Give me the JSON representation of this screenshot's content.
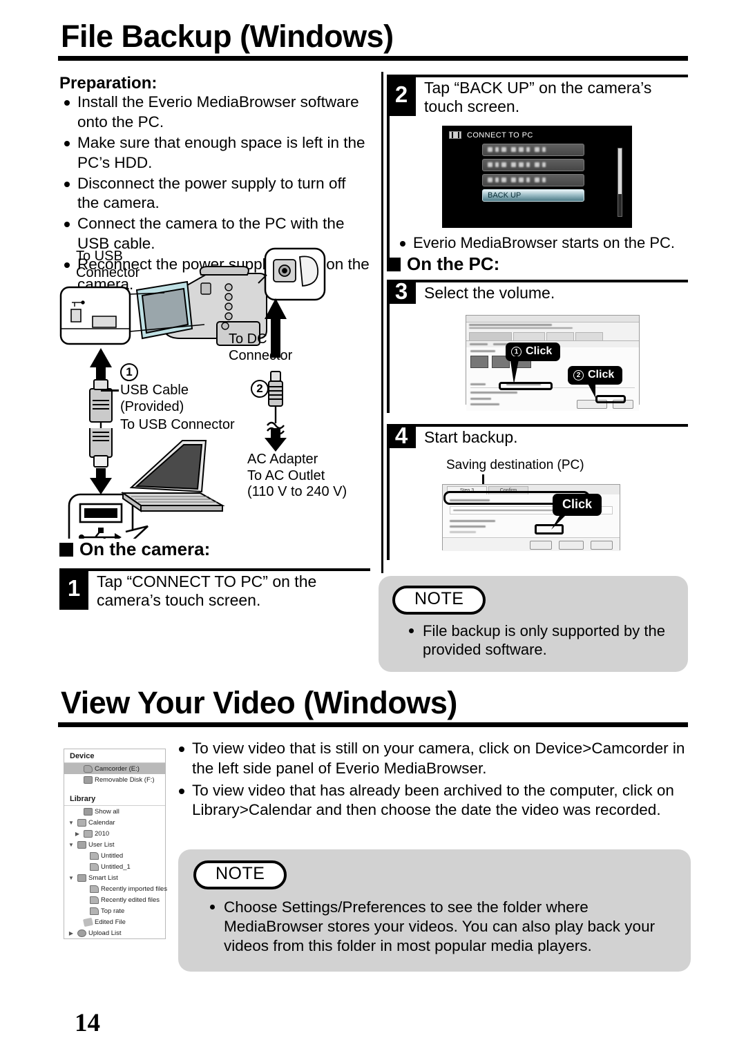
{
  "document": {
    "page_number": "14"
  },
  "section1": {
    "title": "File Backup (Windows)",
    "preparation": {
      "heading": "Preparation:",
      "items": [
        "Install the Everio MediaBrowser software onto the PC.",
        "Make sure that enough space is left in the PC’s HDD.",
        "Disconnect the power supply to turn off the camera.",
        "Connect the camera to the PC with the USB cable.",
        "Reconnect the power supply to turn on the camera."
      ]
    },
    "diagram": {
      "label_usb_connector_camera": "To USB\nConnector",
      "label_dc_connector": "To DC\nConnector",
      "label_usb_cable": "USB Cable\n(Provided)",
      "label_to_usb_connector_pc": "To USB Connector",
      "label_ac_adapter": "AC Adapter\nTo AC Outlet\n(110 V to 240 V)",
      "marker_1": "1",
      "marker_2": "2"
    },
    "on_the_camera": {
      "heading": "On the camera:",
      "step1": {
        "number": "1",
        "text": "Tap “CONNECT TO PC” on the camera’s touch screen."
      }
    },
    "step2": {
      "number": "2",
      "text": "Tap “BACK UP” on the camera’s touch screen.",
      "lcd": {
        "title": "CONNECT TO PC",
        "selected_item": "BACK UP",
        "hidden_items": 3
      },
      "note_bullet": "Everio MediaBrowser starts on the PC."
    },
    "on_the_pc": {
      "heading": "On the PC:",
      "step3": {
        "number": "3",
        "text": "Select the volume.",
        "callout1": {
          "index": "1",
          "label": "Click"
        },
        "callout2": {
          "index": "2",
          "label": "Click"
        }
      },
      "step4": {
        "number": "4",
        "text": "Start backup.",
        "caption": "Saving destination (PC)",
        "callout": {
          "label": "Click"
        },
        "shot_tabs": [
          "Step.3",
          "Confirm"
        ]
      }
    },
    "note": {
      "badge": "NOTE",
      "items": [
        "File backup is only supported by the provided software."
      ]
    }
  },
  "section2": {
    "title": "View Your Video (Windows)",
    "bullets": [
      "To view video that is still on your camera, click on Device>Camcorder in the left side panel of Everio MediaBrowser.",
      "To view video that has already been archived to the computer, click on Library>Calendar and then choose the date the video was recorded."
    ],
    "tree": {
      "groups": [
        {
          "label": "Device",
          "items": [
            {
              "label": "Camcorder (E:)",
              "icon": "camcorder-icon",
              "selected": true,
              "arrow": "",
              "indent": 1
            },
            {
              "label": "Removable Disk (F:)",
              "icon": "disk-icon",
              "selected": false,
              "arrow": "",
              "indent": 1
            }
          ]
        },
        {
          "label": "Library",
          "items": [
            {
              "label": "Show all",
              "icon": "folder-icon",
              "selected": false,
              "arrow": "",
              "indent": 1
            },
            {
              "label": "Calendar",
              "icon": "calendar-icon",
              "selected": false,
              "arrow": "▼",
              "indent": 0
            },
            {
              "label": "2010",
              "icon": "calendar-icon",
              "selected": false,
              "arrow": "▶",
              "indent": 1
            },
            {
              "label": "User List",
              "icon": "list-icon",
              "selected": false,
              "arrow": "▼",
              "indent": 0
            },
            {
              "label": "Untitled",
              "icon": "flag-icon",
              "selected": false,
              "arrow": "",
              "indent": 2
            },
            {
              "label": "Untitled_1",
              "icon": "flag-icon",
              "selected": false,
              "arrow": "",
              "indent": 2
            },
            {
              "label": "Smart List",
              "icon": "list-icon",
              "selected": false,
              "arrow": "▼",
              "indent": 0
            },
            {
              "label": "Recently imported files",
              "icon": "flag-icon",
              "selected": false,
              "arrow": "",
              "indent": 2
            },
            {
              "label": "Recently edited files",
              "icon": "flag-icon",
              "selected": false,
              "arrow": "",
              "indent": 2
            },
            {
              "label": "Top rate",
              "icon": "flag-icon",
              "selected": false,
              "arrow": "",
              "indent": 2
            },
            {
              "label": "Edited File",
              "icon": "edited-icon",
              "selected": false,
              "arrow": "",
              "indent": 1
            },
            {
              "label": "Upload List",
              "icon": "upload-icon",
              "selected": false,
              "arrow": "▶",
              "indent": 0
            }
          ]
        }
      ]
    },
    "note": {
      "badge": "NOTE",
      "items": [
        "Choose Settings/Preferences to see the folder where MediaBrowser stores your videos. You can also play back your videos from this folder in most popular media players."
      ]
    }
  }
}
